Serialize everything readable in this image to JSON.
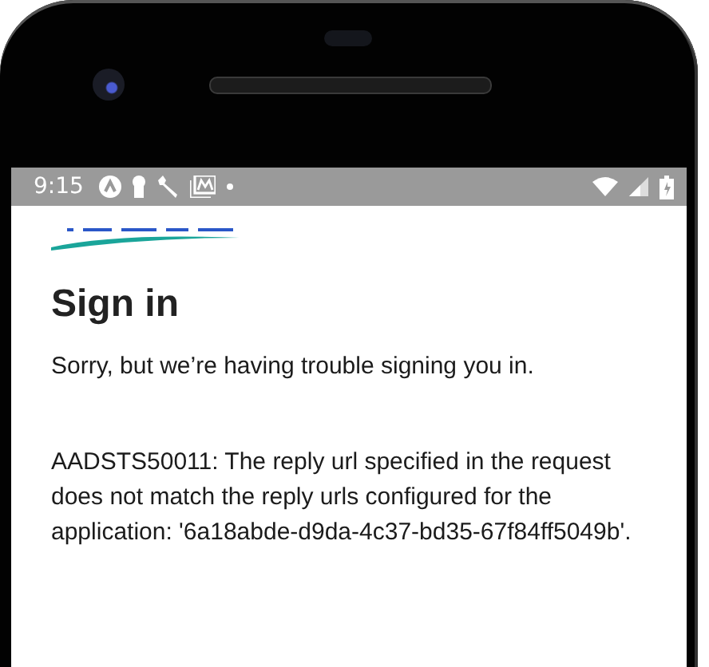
{
  "status_bar": {
    "time": "9:15"
  },
  "page": {
    "title": "Sign in",
    "message": "Sorry, but we’re having trouble signing you in.",
    "error": "AADSTS50011: The reply url specified in the request does not match the reply urls configured for the application: '6a18abde-d9da-4c37-bd35-67f84ff5049b'."
  }
}
